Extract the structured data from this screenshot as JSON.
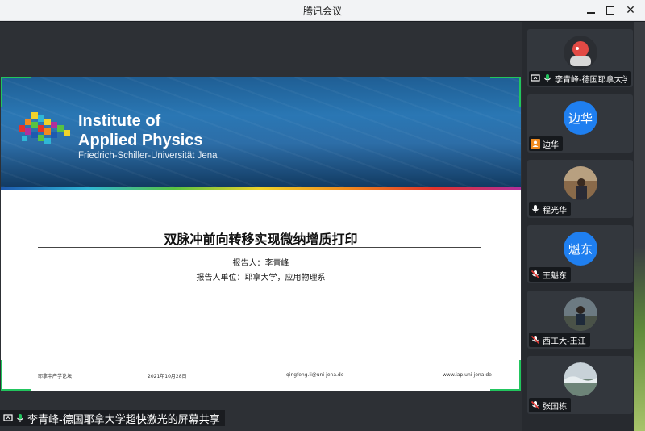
{
  "window": {
    "title": "腾讯会议"
  },
  "slide": {
    "institute_line1": "Institute of",
    "institute_line2": "Applied Physics",
    "university": "Friedrich-Schiller-Universität Jena",
    "title": "双脉冲前向转移实现微纳增质打印",
    "reporter": "报告人：李青峰",
    "affiliation": "报告人单位：耶拿大学，应用物理系",
    "footer": {
      "event": "耶拿中产学论坛",
      "date": "2021年10月28日",
      "email": "qingfeng.li@uni-jena.de",
      "website": "www.iap.uni-jena.de"
    }
  },
  "share_label": "李青峰-德国耶拿大学超快激光的屏幕共享",
  "participants": [
    {
      "name": "李青峰-德国耶拿大学",
      "avatar": "photo",
      "icon": "screen-share-icon",
      "mic": "on"
    },
    {
      "name": "边华",
      "avatar": "text",
      "avatar_text": "边华",
      "icon": "person-icon",
      "mic": "none"
    },
    {
      "name": "程光华",
      "avatar": "photo",
      "icon": "none",
      "mic": "on"
    },
    {
      "name": "王魁东",
      "avatar": "text",
      "avatar_text": "魁东",
      "icon": "none",
      "mic": "muted"
    },
    {
      "name": "西工大-王江",
      "avatar": "photo",
      "icon": "none",
      "mic": "muted"
    },
    {
      "name": "张国栋",
      "avatar": "photo",
      "icon": "none",
      "mic": "muted"
    }
  ],
  "colors": {
    "avatar_blue": "#1f7ff0",
    "mic_green": "#22c55e",
    "muted_red": "#e53935",
    "share_corner": "#22c55e"
  }
}
